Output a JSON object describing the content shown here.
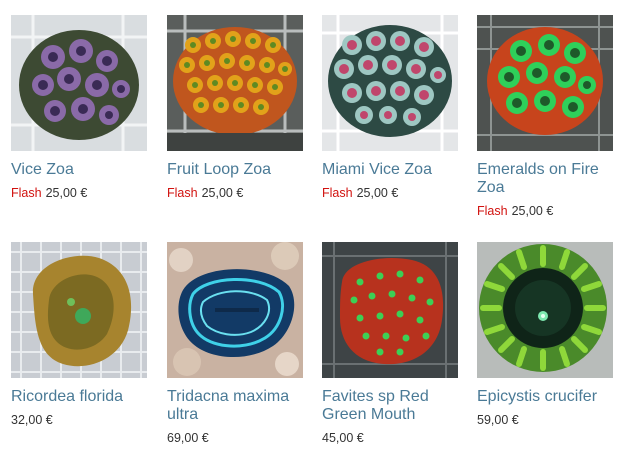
{
  "products": [
    {
      "name": "Vice Zoa",
      "badge": "Flash",
      "price": "25,00 €",
      "image": "zoanthid-coral-photo"
    },
    {
      "name": "Fruit Loop Zoa",
      "badge": "Flash",
      "price": "25,00 €",
      "image": "zoanthid-coral-photo"
    },
    {
      "name": "Miami Vice Zoa",
      "badge": "Flash",
      "price": "25,00 €",
      "image": "zoanthid-coral-photo"
    },
    {
      "name": "Emeralds on Fire Zoa",
      "badge": "Flash",
      "price": "25,00 €",
      "image": "zoanthid-coral-photo"
    },
    {
      "name": "Ricordea florida",
      "badge": "",
      "price": "32,00 €",
      "image": "ricordea-coral-photo"
    },
    {
      "name": "Tridacna maxima ultra",
      "badge": "",
      "price": "69,00 €",
      "image": "giant-clam-photo"
    },
    {
      "name": "Favites sp Red Green Mouth",
      "badge": "",
      "price": "45,00 €",
      "image": "favites-coral-photo"
    },
    {
      "name": "Epicystis crucifer",
      "badge": "",
      "price": "59,00 €",
      "image": "anemone-photo"
    }
  ],
  "colors": {
    "link": "#4a7a96",
    "flash": "#d2120f",
    "price": "#333333"
  }
}
